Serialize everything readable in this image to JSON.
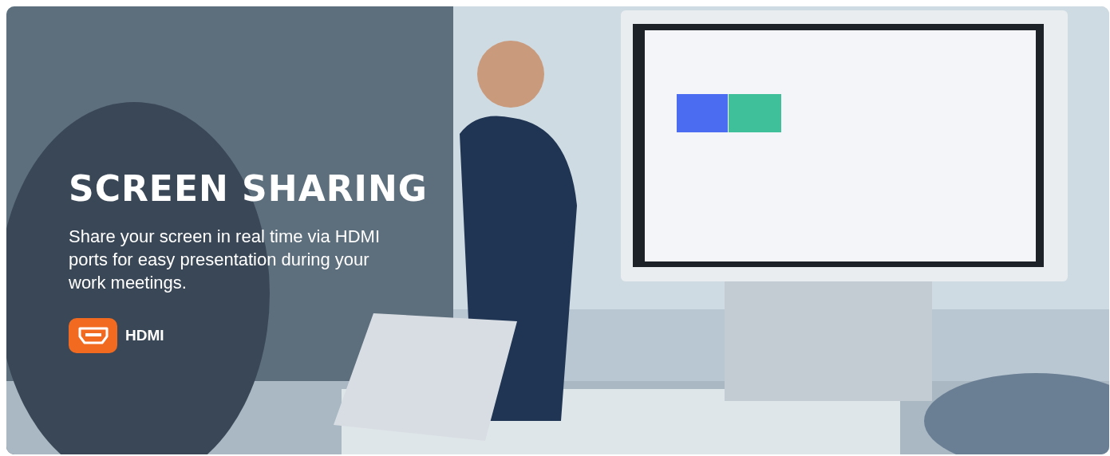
{
  "banner": {
    "title": "SCREEN SHARING",
    "description": "Share your screen in real time via HDMI ports for easy presentation during your work meetings.",
    "feature": {
      "label": "HDMI"
    }
  }
}
